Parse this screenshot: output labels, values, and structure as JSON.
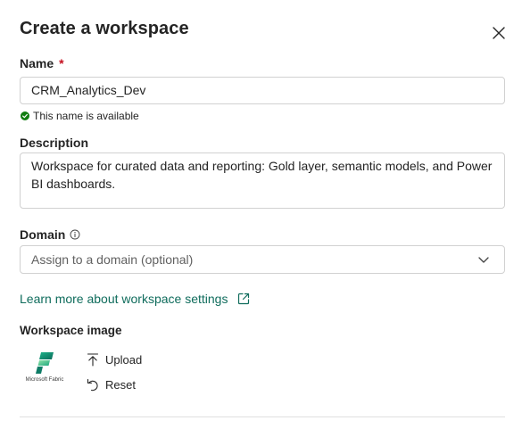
{
  "dialog": {
    "title": "Create a workspace"
  },
  "name_field": {
    "label": "Name",
    "required_marker": "*",
    "value": "CRM_Analytics_Dev",
    "availability": "This name is available"
  },
  "description_field": {
    "label": "Description",
    "value": "Workspace for curated data and reporting: Gold layer, semantic models, and Power BI dashboards."
  },
  "domain_field": {
    "label": "Domain",
    "placeholder": "Assign to a domain (optional)"
  },
  "learn_more": {
    "label": "Learn more about workspace settings"
  },
  "workspace_image": {
    "label": "Workspace image",
    "logo_text": "Microsoft Fabric",
    "upload_label": "Upload",
    "reset_label": "Reset"
  },
  "colors": {
    "link": "#0f6c5c",
    "success": "#107c10",
    "required": "#c50f1f",
    "border": "#d1d1d1"
  },
  "icons": [
    "close-icon",
    "check-circle-icon",
    "info-icon",
    "chevron-down-icon",
    "external-link-icon",
    "upload-icon",
    "reset-icon",
    "fabric-logo"
  ]
}
